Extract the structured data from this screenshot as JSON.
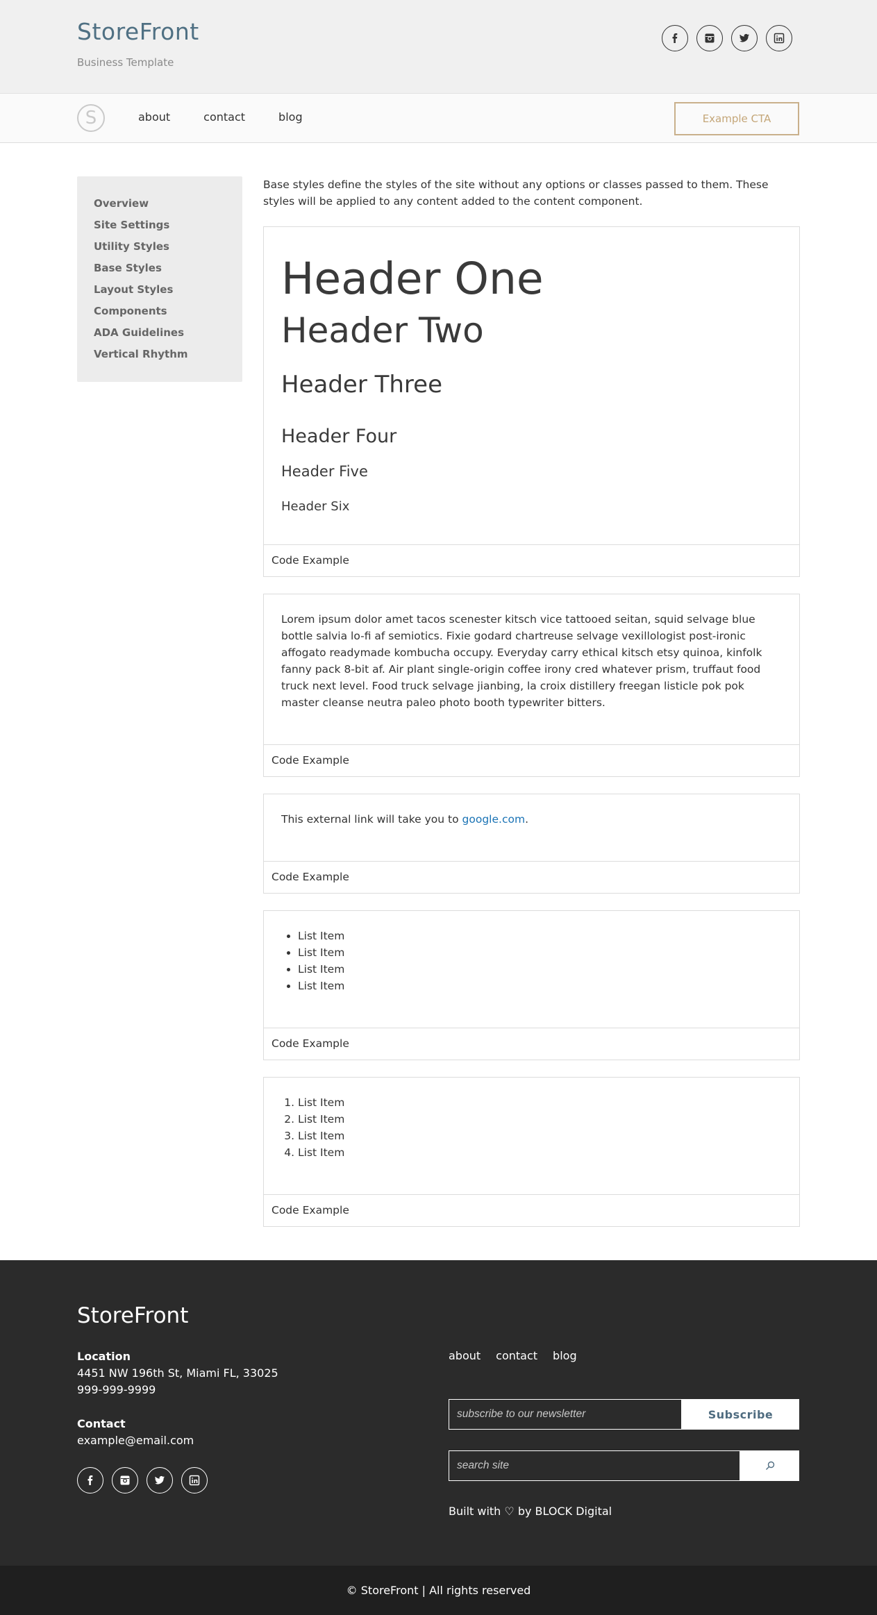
{
  "header": {
    "brand": "StoreFront",
    "tagline": "Business Template",
    "social": [
      "facebook-icon",
      "instagram-icon",
      "twitter-icon",
      "linkedin-icon"
    ]
  },
  "nav": {
    "logo_letter": "S",
    "links": [
      "about",
      "contact",
      "blog"
    ],
    "cta": "Example CTA"
  },
  "sidebar": {
    "items": [
      "Overview",
      "Site Settings",
      "Utility Styles",
      "Base Styles",
      "Layout Styles",
      "Components",
      "ADA Guidelines",
      "Vertical Rhythm"
    ]
  },
  "main": {
    "intro": "Base styles define the styles of the site without any options or classes passed to them. These styles will be applied to any content added to the content component.",
    "headers": [
      "Header One",
      "Header Two",
      "Header Three",
      "Header Four",
      "Header Five",
      "Header Six"
    ],
    "paragraph": "Lorem ipsum dolor amet tacos scenester kitsch vice tattooed seitan, squid selvage blue bottle salvia lo-fi af semiotics. Fixie godard chartreuse selvage vexillologist post-ironic affogato readymade kombucha occupy. Everyday carry ethical kitsch etsy quinoa, kinfolk fanny pack 8-bit af. Air plant single-origin coffee irony cred whatever prism, truffaut food truck next level. Food truck selvage jianbing, la croix distillery freegan listicle pok pok master cleanse neutra paleo photo booth typewriter bitters.",
    "link_prefix": "This external link will take you to ",
    "link_text": "google.com",
    "link_suffix": ".",
    "ul_items": [
      "List Item",
      "List Item",
      "List Item",
      "List Item"
    ],
    "ol_items": [
      "List Item",
      "List Item",
      "List Item",
      "List Item"
    ],
    "code_example": "Code Example"
  },
  "footer": {
    "brand": "StoreFront",
    "location_label": "Location",
    "address": "4451 NW 196th St, Miami FL, 33025",
    "phone": "999-999-9999",
    "contact_label": "Contact",
    "email": "example@email.com",
    "links": [
      "about",
      "contact",
      "blog"
    ],
    "newsletter_placeholder": "subscribe to our newsletter",
    "subscribe": "Subscribe",
    "search_placeholder": "search site",
    "built_with": "Built with ♡ by BLOCK Digital",
    "copyright": "© StoreFront | All rights reserved"
  },
  "colors": {
    "brand": "#4f7083",
    "cta": "#c4a678",
    "link": "#1a73b5",
    "footer_bg": "#2b2b2b",
    "bottom_bg": "#1f1f1f"
  }
}
